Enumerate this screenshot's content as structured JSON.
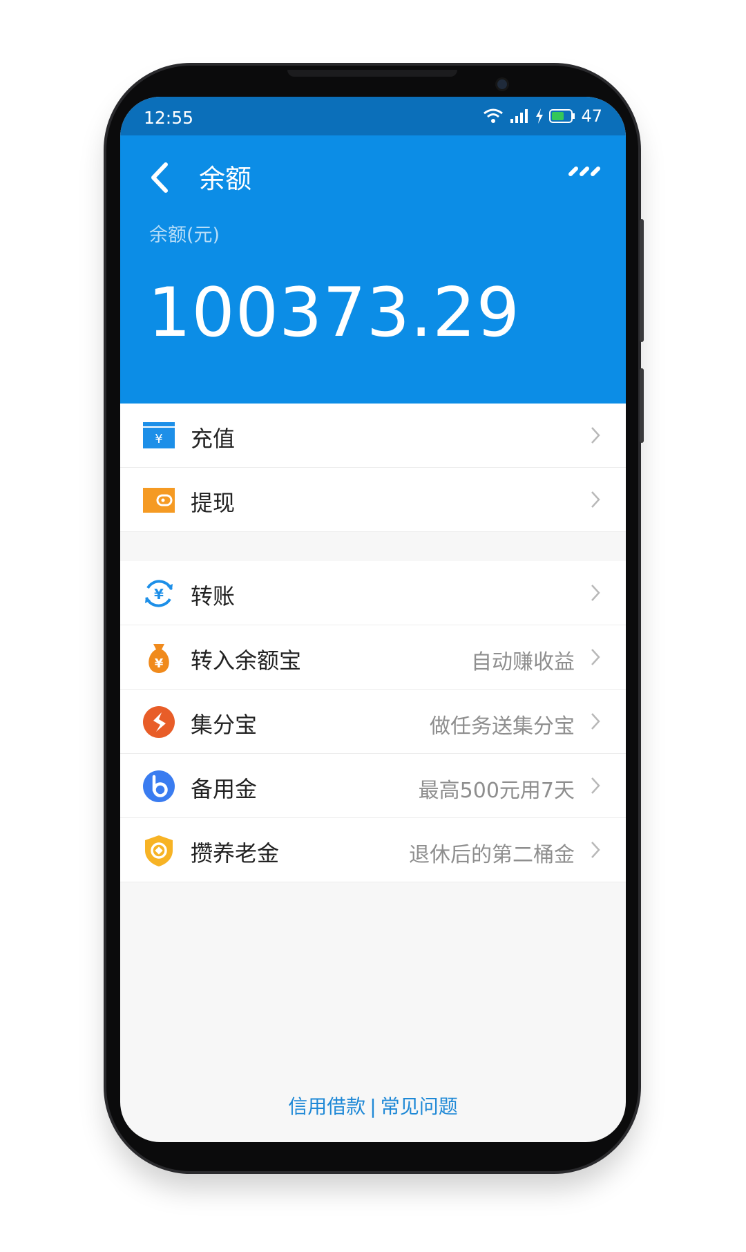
{
  "status": {
    "time": "12:55",
    "battery": "47"
  },
  "header": {
    "title": "余额",
    "balance_label": "余额(元)",
    "balance": "100373.29"
  },
  "group1": [
    {
      "label": "充值",
      "hint": "",
      "icon": "recharge-card-icon"
    },
    {
      "label": "提现",
      "hint": "",
      "icon": "wallet-icon"
    }
  ],
  "group2": [
    {
      "label": "转账",
      "hint": "",
      "icon": "transfer-yuan-icon"
    },
    {
      "label": "转入余额宝",
      "hint": "自动赚收益",
      "icon": "money-bag-icon"
    },
    {
      "label": "集分宝",
      "hint": "做任务送集分宝",
      "icon": "points-icon"
    },
    {
      "label": "备用金",
      "hint": "最高500元用7天",
      "icon": "reserve-b-icon"
    },
    {
      "label": "攒养老金",
      "hint": "退休后的第二桶金",
      "icon": "pension-shield-icon"
    }
  ],
  "footer": {
    "link1": "信用借款",
    "separator": "|",
    "link2": "常见问题"
  },
  "colors": {
    "primary": "#0c8de6",
    "statusbar": "#0b6fba",
    "link": "#1e88d6"
  }
}
